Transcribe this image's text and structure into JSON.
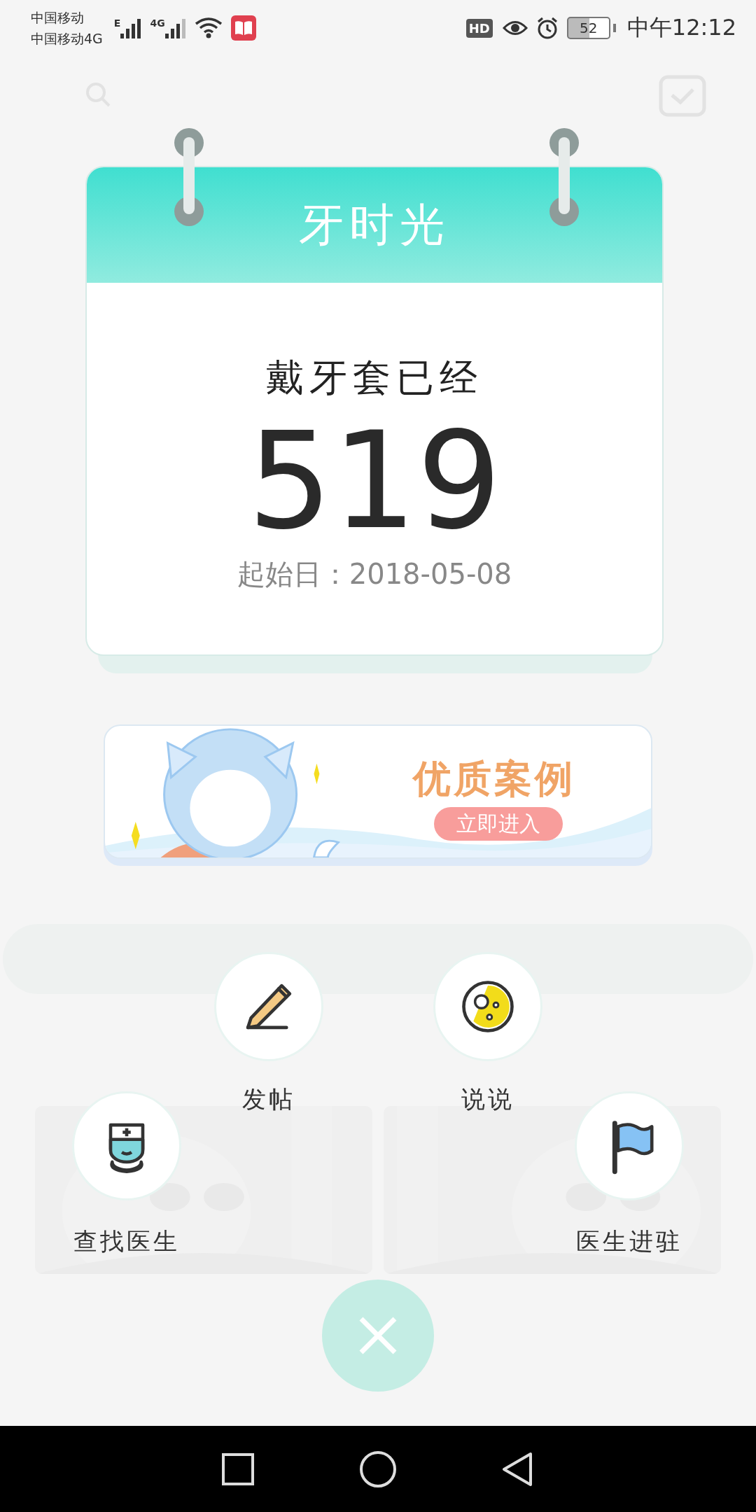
{
  "status_bar": {
    "carrier_1": "中国移动",
    "carrier_2": "中国移动4G",
    "network_1": "E",
    "network_2": "4G",
    "badge": "HD",
    "battery": "52",
    "time": "中午12:12"
  },
  "calendar": {
    "title": "牙时光",
    "caption": "戴牙套已经",
    "days": "519",
    "start_date": "起始日：2018-05-08"
  },
  "banner": {
    "title": "优质案例",
    "button": "立即进入"
  },
  "actions": [
    {
      "label": "发帖",
      "kind": "post"
    },
    {
      "label": "说说",
      "kind": "moment"
    },
    {
      "label": "查找医生",
      "kind": "find_doctor"
    },
    {
      "label": "医生进驻",
      "kind": "doctor_join"
    }
  ]
}
